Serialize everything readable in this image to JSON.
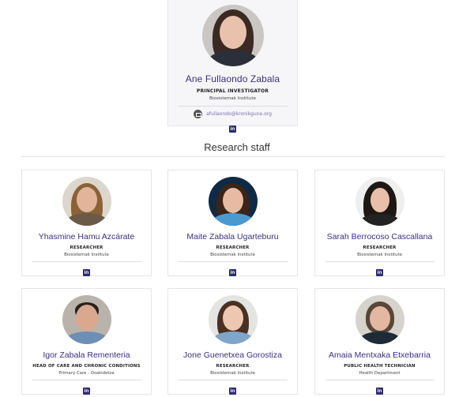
{
  "pi": {
    "name": "Ane Fullaondo Zabala",
    "role": "PRINCIPAL INVESTIGATOR",
    "institute": "Biosistemak Institute",
    "email": "afullaondo@kronikgune.org",
    "email_icon": "mail-icon",
    "linkedin_icon": "linkedin-icon",
    "linkedin_glyph": "in"
  },
  "section": {
    "title": "Research staff"
  },
  "staff": [
    {
      "name": "Yhasmine Hamu Azcárate",
      "role": "RESEARCHER",
      "institute": "Biosistemak Institute",
      "linkedin_glyph": "in"
    },
    {
      "name": "Maite Zabala Ugarteburu",
      "role": "RESEARCHER",
      "institute": "Biosistemak Institute",
      "linkedin_glyph": "in"
    },
    {
      "name": "Sarah Berrocoso Cascallana",
      "role": "RESEARCHER",
      "institute": "Biosistemak Institute",
      "linkedin_glyph": "in"
    },
    {
      "name": "Igor Zabala Rementeria",
      "role": "HEAD OF CARE AND CHRONIC CONDITIONS",
      "institute": "Primary Care - Osakidetza",
      "linkedin_glyph": "in"
    },
    {
      "name": "Jone Guenetxea Gorostiza",
      "role": "RESEARCHER",
      "institute": "Biosistemak Institute",
      "linkedin_glyph": "in"
    },
    {
      "name": "Amaia Mentxaka Etxebarria",
      "role": "PUBLIC HEALTH TECHNICIAN",
      "institute": "Health Department",
      "linkedin_glyph": "in"
    }
  ],
  "colors": {
    "name": "#3b2f7f",
    "linkedin": "#2d2a6e",
    "email": "#7a6fb0"
  }
}
